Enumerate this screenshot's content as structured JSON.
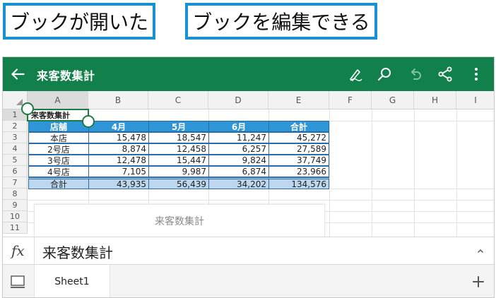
{
  "callouts": {
    "left": "ブックが開いた",
    "right": "ブックを編集できる"
  },
  "appbar": {
    "title": "来客数集計",
    "icons": [
      "back-arrow-icon",
      "pen-icon",
      "search-icon",
      "undo-icon",
      "share-icon",
      "more-vert-icon"
    ]
  },
  "sheet": {
    "columns": [
      "A",
      "B",
      "C",
      "D",
      "E",
      "F",
      "G",
      "H",
      "I"
    ],
    "rows": [
      "1",
      "2",
      "3",
      "4",
      "5",
      "6",
      "7",
      "8",
      "9",
      "10",
      "11"
    ],
    "title_cell": "来客数集計",
    "table": {
      "header": [
        "店舗",
        "4月",
        "5月",
        "6月",
        "合計"
      ],
      "rows": [
        [
          "本店",
          "15,478",
          "18,547",
          "11,247",
          "45,272"
        ],
        [
          "2号店",
          "8,874",
          "12,458",
          "6,257",
          "27,589"
        ],
        [
          "3号店",
          "12,478",
          "15,447",
          "9,824",
          "37,749"
        ],
        [
          "4号店",
          "7,105",
          "9,987",
          "6,874",
          "23,966"
        ]
      ],
      "total": [
        "合計",
        "43,935",
        "56,439",
        "34,202",
        "134,576"
      ]
    }
  },
  "popup": {
    "text": "来客数集計"
  },
  "formula_bar": {
    "fx_label": "fx",
    "content": "来客数集計"
  },
  "sheet_tabs": {
    "active": "Sheet1"
  },
  "colors": {
    "brand_green": "#12804a",
    "callout_border": "#1890d5",
    "header_fill": "#2f95d6",
    "total_fill": "#bcd7ee"
  }
}
